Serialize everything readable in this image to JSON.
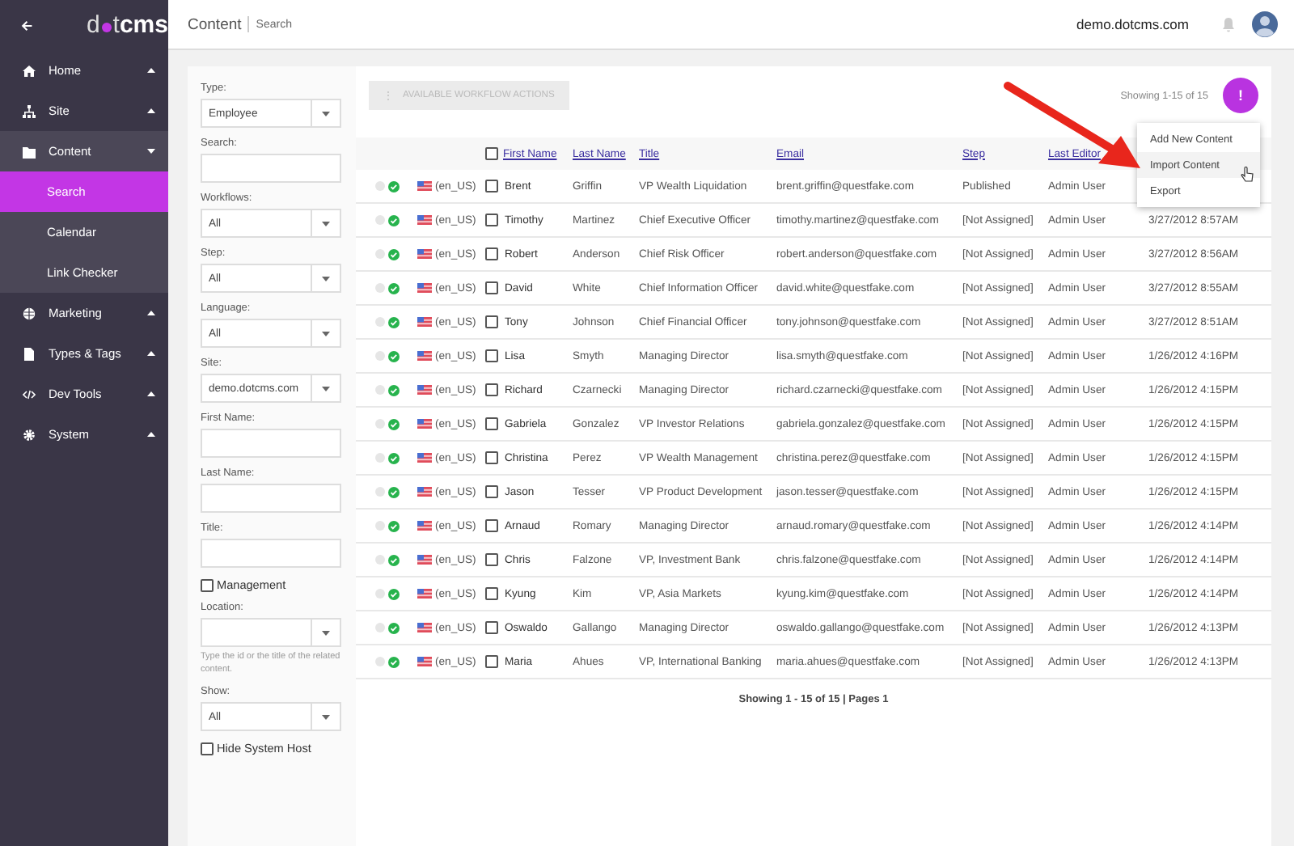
{
  "sidebar": {
    "logo": {
      "left": "d",
      "middle": "t",
      "bold": "cms"
    },
    "items": [
      {
        "label": "Home",
        "expanded": false
      },
      {
        "label": "Site",
        "expanded": false
      },
      {
        "label": "Content",
        "expanded": true,
        "children": [
          {
            "label": "Search",
            "selected": true
          },
          {
            "label": "Calendar",
            "selected": false
          },
          {
            "label": "Link Checker",
            "selected": false
          }
        ]
      },
      {
        "label": "Marketing",
        "expanded": false
      },
      {
        "label": "Types & Tags",
        "expanded": false
      },
      {
        "label": "Dev Tools",
        "expanded": false
      },
      {
        "label": "System",
        "expanded": false
      }
    ]
  },
  "header": {
    "section": "Content",
    "page": "Search",
    "site": "demo.dotcms.com"
  },
  "filters": [
    {
      "kind": "select",
      "label": "Type:",
      "value": "Employee"
    },
    {
      "kind": "text",
      "label": "Search:"
    },
    {
      "kind": "select",
      "label": "Workflows:",
      "value": "All"
    },
    {
      "kind": "select",
      "label": "Step:",
      "value": "All"
    },
    {
      "kind": "select",
      "label": "Language:",
      "value": "All"
    },
    {
      "kind": "select",
      "label": "Site:",
      "value": "demo.dotcms.com"
    },
    {
      "kind": "text",
      "label": "First Name:"
    },
    {
      "kind": "text",
      "label": "Last Name:"
    },
    {
      "kind": "text",
      "label": "Title:"
    },
    {
      "kind": "checkbox",
      "label": "Management",
      "checked": false
    },
    {
      "kind": "select",
      "label": "Location:",
      "hint": "Type the id or the title of the related content."
    },
    {
      "kind": "select",
      "label": "Show:",
      "value": "All"
    },
    {
      "kind": "checkbox",
      "label": "Hide System Host",
      "checked": false
    }
  ],
  "toolbar": {
    "workflow_icon": "⋮",
    "workflow_button": "AVAILABLE WORKFLOW ACTIONS",
    "showing": "Showing 1-15 of 15",
    "fab": "!"
  },
  "menu": [
    {
      "label": "Add New Content",
      "selected": false
    },
    {
      "label": "Import Content",
      "selected": true
    },
    {
      "label": "Export",
      "selected": false
    }
  ],
  "table": {
    "select_all_checked": false,
    "columns": [
      "First Name",
      "Last Name",
      "Title",
      "Email",
      "Step",
      "Last Editor"
    ],
    "rows": [
      {
        "lang": "(en_US)",
        "checked": false,
        "first": "Brent",
        "last": "Griffin",
        "title": "VP Wealth Liquidation",
        "email": "brent.griffin@questfake.com",
        "step": "Published",
        "editor": "Admin User"
      },
      {
        "lang": "(en_US)",
        "checked": false,
        "first": "Timothy",
        "last": "Martinez",
        "title": "Chief Executive Officer",
        "email": "timothy.martinez@questfake.com",
        "step": "[Not Assigned]",
        "editor": "Admin User",
        "date": "3/27/2012 8:57AM"
      },
      {
        "lang": "(en_US)",
        "checked": false,
        "first": "Robert",
        "last": "Anderson",
        "title": "Chief Risk Officer",
        "email": "robert.anderson@questfake.com",
        "step": "[Not Assigned]",
        "editor": "Admin User",
        "date": "3/27/2012 8:56AM"
      },
      {
        "lang": "(en_US)",
        "checked": false,
        "first": "David",
        "last": "White",
        "title": "Chief Information Officer",
        "email": "david.white@questfake.com",
        "step": "[Not Assigned]",
        "editor": "Admin User",
        "date": "3/27/2012 8:55AM"
      },
      {
        "lang": "(en_US)",
        "checked": false,
        "first": "Tony",
        "last": "Johnson",
        "title": "Chief Financial Officer",
        "email": "tony.johnson@questfake.com",
        "step": "[Not Assigned]",
        "editor": "Admin User",
        "date": "3/27/2012 8:51AM"
      },
      {
        "lang": "(en_US)",
        "checked": false,
        "first": "Lisa",
        "last": "Smyth",
        "title": "Managing Director",
        "email": "lisa.smyth@questfake.com",
        "step": "[Not Assigned]",
        "editor": "Admin User",
        "date": "1/26/2012 4:16PM"
      },
      {
        "lang": "(en_US)",
        "checked": false,
        "first": "Richard",
        "last": "Czarnecki",
        "title": "Managing Director",
        "email": "richard.czarnecki@questfake.com",
        "step": "[Not Assigned]",
        "editor": "Admin User",
        "date": "1/26/2012 4:15PM"
      },
      {
        "lang": "(en_US)",
        "checked": false,
        "first": "Gabriela",
        "last": "Gonzalez",
        "title": "VP Investor Relations",
        "email": "gabriela.gonzalez@questfake.com",
        "step": "[Not Assigned]",
        "editor": "Admin User",
        "date": "1/26/2012 4:15PM"
      },
      {
        "lang": "(en_US)",
        "checked": false,
        "first": "Christina",
        "last": "Perez",
        "title": "VP Wealth Management",
        "email": "christina.perez@questfake.com",
        "step": "[Not Assigned]",
        "editor": "Admin User",
        "date": "1/26/2012 4:15PM"
      },
      {
        "lang": "(en_US)",
        "checked": false,
        "first": "Jason",
        "last": "Tesser",
        "title": "VP Product Development",
        "email": "jason.tesser@questfake.com",
        "step": "[Not Assigned]",
        "editor": "Admin User",
        "date": "1/26/2012 4:15PM"
      },
      {
        "lang": "(en_US)",
        "checked": false,
        "first": "Arnaud",
        "last": "Romary",
        "title": "Managing Director",
        "email": "arnaud.romary@questfake.com",
        "step": "[Not Assigned]",
        "editor": "Admin User",
        "date": "1/26/2012 4:14PM"
      },
      {
        "lang": "(en_US)",
        "checked": false,
        "first": "Chris",
        "last": "Falzone",
        "title": "VP, Investment Bank",
        "email": "chris.falzone@questfake.com",
        "step": "[Not Assigned]",
        "editor": "Admin User",
        "date": "1/26/2012 4:14PM"
      },
      {
        "lang": "(en_US)",
        "checked": false,
        "first": "Kyung",
        "last": "Kim",
        "title": "VP, Asia Markets",
        "email": "kyung.kim@questfake.com",
        "step": "[Not Assigned]",
        "editor": "Admin User",
        "date": "1/26/2012 4:14PM"
      },
      {
        "lang": "(en_US)",
        "checked": false,
        "first": "Oswaldo",
        "last": "Gallango",
        "title": "Managing Director",
        "email": "oswaldo.gallango@questfake.com",
        "step": "[Not Assigned]",
        "editor": "Admin User",
        "date": "1/26/2012 4:13PM"
      },
      {
        "lang": "(en_US)",
        "checked": false,
        "first": "Maria",
        "last": "Ahues",
        "title": "VP, International Banking",
        "email": "maria.ahues@questfake.com",
        "step": "[Not Assigned]",
        "editor": "Admin User",
        "date": "1/26/2012 4:13PM"
      }
    ],
    "footer": "Showing 1 - 15 of 15 | Pages 1"
  }
}
